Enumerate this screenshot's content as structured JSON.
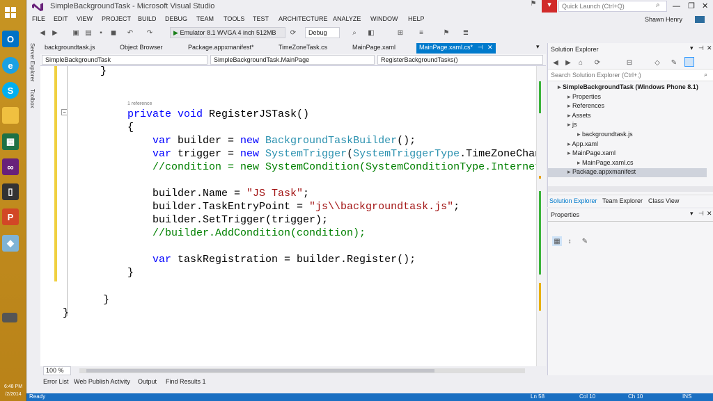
{
  "window": {
    "title": "SimpleBackgroundTask - Microsoft Visual Studio",
    "quick_launch_placeholder": "Quick Launch (Ctrl+Q)",
    "user": "Shawn Henry"
  },
  "menu": [
    "FILE",
    "EDIT",
    "VIEW",
    "PROJECT",
    "BUILD",
    "DEBUG",
    "TEAM",
    "TOOLS",
    "TEST",
    "ARCHITECTURE",
    "ANALYZE",
    "WINDOW",
    "HELP"
  ],
  "toolbar": {
    "run_target": "Emulator 8.1 WVGA 4 inch 512MB",
    "configuration": "Debug"
  },
  "side_tabs": [
    "Server Explorer",
    "Toolbox"
  ],
  "doc_tabs": [
    {
      "label": "backgroundtask.js",
      "active": false
    },
    {
      "label": "Object Browser",
      "active": false
    },
    {
      "label": "Package.appxmanifest*",
      "active": false
    },
    {
      "label": "TimeZoneTask.cs",
      "active": false
    },
    {
      "label": "MainPage.xaml",
      "active": false
    },
    {
      "label": "MainPage.xaml.cs*",
      "active": true
    }
  ],
  "nav": {
    "project": "SimpleBackgroundTask",
    "class": "SimpleBackgroundTask.MainPage",
    "member": "RegisterBackgroundTasks()"
  },
  "code": {
    "brace_top": "}",
    "ref_count": "1 reference",
    "lines": [
      [
        {
          "t": "private void ",
          "c": "kw"
        },
        {
          "t": "RegisterJSTask()",
          "c": ""
        }
      ],
      [
        {
          "t": "{",
          "c": ""
        }
      ],
      [
        {
          "t": "    var ",
          "c": "kw"
        },
        {
          "t": "builder = ",
          "c": ""
        },
        {
          "t": "new ",
          "c": "kw"
        },
        {
          "t": "BackgroundTaskBuilder",
          "c": "ty"
        },
        {
          "t": "();",
          "c": ""
        }
      ],
      [
        {
          "t": "    var ",
          "c": "kw"
        },
        {
          "t": "trigger = ",
          "c": ""
        },
        {
          "t": "new ",
          "c": "kw"
        },
        {
          "t": "SystemTrigger",
          "c": "ty"
        },
        {
          "t": "(",
          "c": ""
        },
        {
          "t": "SystemTriggerType",
          "c": "ty"
        },
        {
          "t": ".TimeZoneChan",
          "c": ""
        }
      ],
      [
        {
          "t": "    //condition = new SystemCondition(SystemConditionType.Internet",
          "c": "cm"
        }
      ],
      [
        {
          "t": "",
          "c": ""
        }
      ],
      [
        {
          "t": "    builder.Name = ",
          "c": ""
        },
        {
          "t": "\"JS Task\"",
          "c": "str"
        },
        {
          "t": ";",
          "c": ""
        }
      ],
      [
        {
          "t": "    builder.TaskEntryPoint = ",
          "c": ""
        },
        {
          "t": "\"js\\\\backgroundtask.js\"",
          "c": "str"
        },
        {
          "t": ";",
          "c": ""
        }
      ],
      [
        {
          "t": "    builder.SetTrigger(trigger);",
          "c": ""
        }
      ],
      [
        {
          "t": "    //builder.AddCondition(condition);",
          "c": "cm"
        }
      ],
      [
        {
          "t": "",
          "c": ""
        }
      ],
      [
        {
          "t": "    var ",
          "c": "kw"
        },
        {
          "t": "taskRegistration = builder.Register();",
          "c": ""
        }
      ],
      [
        {
          "t": "}",
          "c": ""
        }
      ]
    ],
    "close_method": "}",
    "close_class": "}"
  },
  "editor": {
    "zoom": "100 %"
  },
  "solution_explorer": {
    "title": "Solution Explorer",
    "search_placeholder": "Search Solution Explorer (Ctrl+;)",
    "items": [
      {
        "label": "SimpleBackgroundTask (Windows Phone 8.1)",
        "depth": 0,
        "bold": true,
        "selected": false
      },
      {
        "label": "Properties",
        "depth": 1,
        "bold": false,
        "selected": false
      },
      {
        "label": "References",
        "depth": 1,
        "bold": false,
        "selected": false
      },
      {
        "label": "Assets",
        "depth": 1,
        "bold": false,
        "selected": false
      },
      {
        "label": "js",
        "depth": 1,
        "bold": false,
        "selected": false
      },
      {
        "label": "backgroundtask.js",
        "depth": 2,
        "bold": false,
        "selected": false
      },
      {
        "label": "App.xaml",
        "depth": 1,
        "bold": false,
        "selected": false
      },
      {
        "label": "MainPage.xaml",
        "depth": 1,
        "bold": false,
        "selected": false
      },
      {
        "label": "MainPage.xaml.cs",
        "depth": 2,
        "bold": false,
        "selected": false
      },
      {
        "label": "Package.appxmanifest",
        "depth": 1,
        "bold": false,
        "selected": true
      }
    ],
    "tabs": [
      "Solution Explorer",
      "Team Explorer",
      "Class View"
    ]
  },
  "properties": {
    "title": "Properties"
  },
  "bottom_tabs": [
    "Error List",
    "Web Publish Activity",
    "Output",
    "Find Results 1"
  ],
  "status": {
    "ready": "Ready",
    "ln": "Ln 58",
    "col": "Col 10",
    "ch": "Ch 10",
    "ins": "INS"
  },
  "clock": {
    "time": "6:48 PM",
    "date": "/2/2014"
  },
  "colors": {
    "accent": "#007acc",
    "vs_purple": "#68217a",
    "status_blue": "#1a6fc2",
    "taskbar": "#c79423"
  }
}
